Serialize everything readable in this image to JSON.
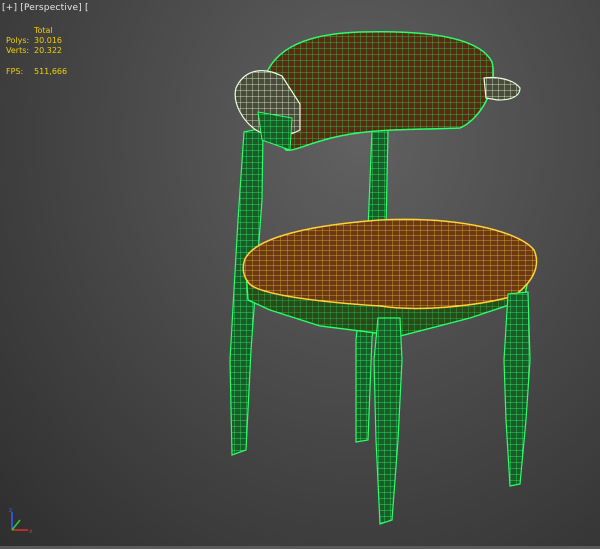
{
  "viewport": {
    "label_parts": [
      "[+]",
      "[Perspective]",
      "["
    ]
  },
  "stats": {
    "header": "Total",
    "polys_label": "Polys:",
    "polys_value": "30.016",
    "verts_label": "Verts:",
    "verts_value": "20.322",
    "fps_label": "FPS:",
    "fps_value": "511,666"
  },
  "colors": {
    "stats_text": "#f0d000",
    "wire_green": "#2aff6a",
    "wire_yellow": "#ffd23a",
    "seat_fill": "#6b3a14",
    "back_fill": "#5a2a12"
  },
  "icons": {
    "axis_gizmo": "axis-gizmo-icon"
  }
}
